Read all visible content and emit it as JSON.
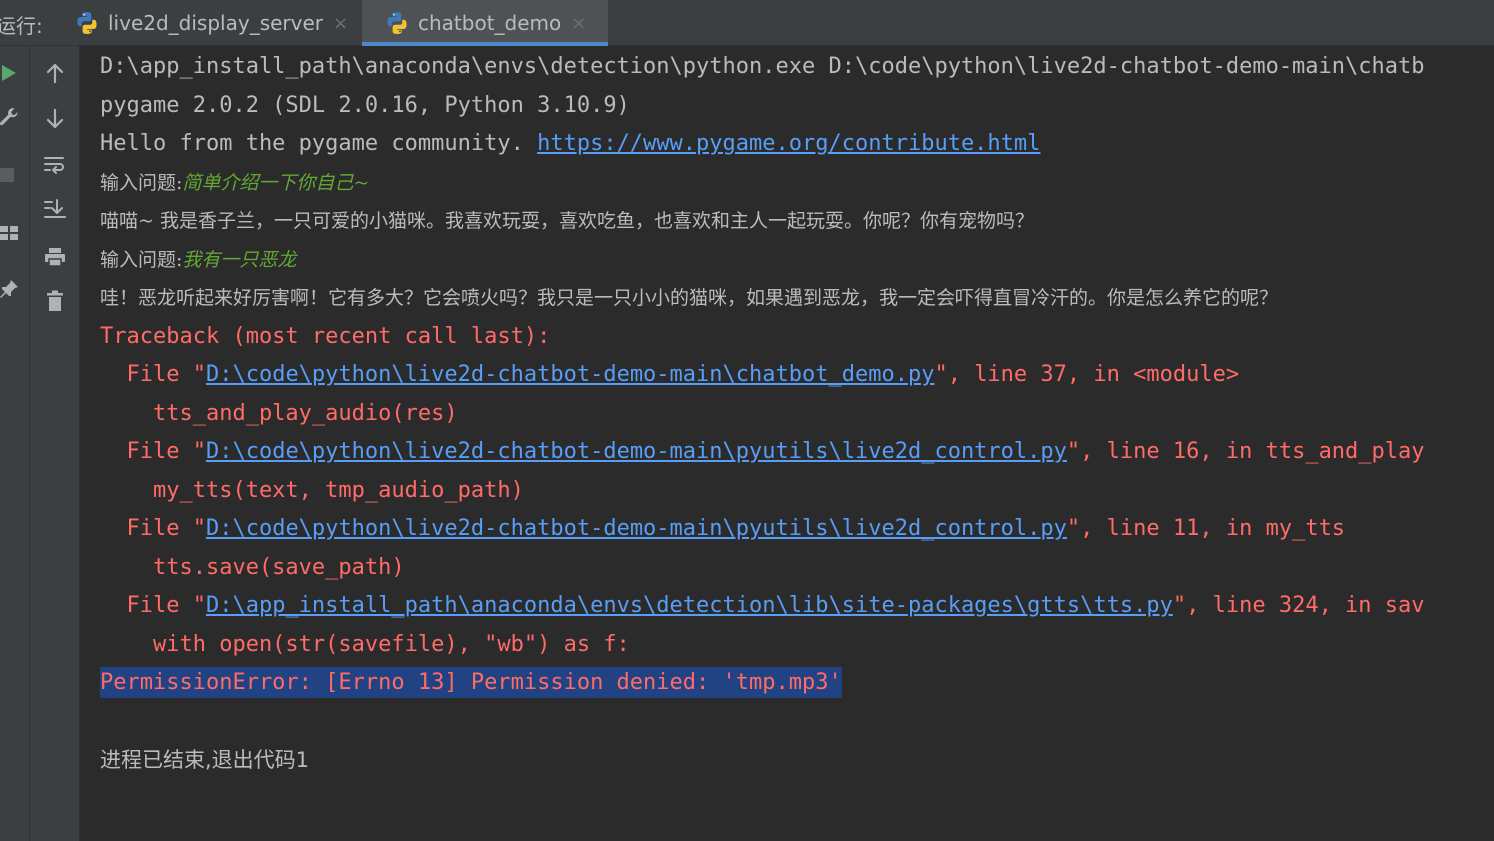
{
  "toolwindow": {
    "run_label": "运行:",
    "tabs": [
      {
        "label": "live2d_display_server",
        "icon": "python-icon",
        "close": "×",
        "active": false
      },
      {
        "label": "chatbot_demo",
        "icon": "python-icon",
        "close": "×",
        "active": true
      }
    ]
  },
  "toolbar_left": {
    "icons": [
      "run-icon",
      "wrench-icon",
      "stop-icon",
      "layout-icon",
      "pin-icon"
    ]
  },
  "toolbar_right": {
    "icons": [
      "arrow-up-icon",
      "arrow-down-icon",
      "soft-wrap-icon",
      "scroll-to-end-icon",
      "print-icon",
      "trash-icon"
    ]
  },
  "console": {
    "cmd_line": "D:\\app_install_path\\anaconda\\envs\\detection\\python.exe D:\\code\\python\\live2d-chatbot-demo-main\\chatb",
    "pygame_version": "pygame 2.0.2 (SDL 2.0.16, Python 3.10.9)",
    "hello_prefix": "Hello from the pygame community. ",
    "hello_link": "https://www.pygame.org/contribute.html",
    "prompt_label": "输入问题:",
    "input_1": "简单介绍一下你自己~",
    "reply_1": "喵喵~ 我是香子兰，一只可爱的小猫咪。我喜欢玩耍，喜欢吃鱼，也喜欢和主人一起玩耍。你呢？你有宠物吗？",
    "input_2": "我有一只恶龙",
    "reply_2": "哇！恶龙听起来好厉害啊！它有多大？它会喷火吗？我只是一只小小的猫咪，如果遇到恶龙，我一定会吓得直冒冷汗的。你是怎么养它的呢？",
    "traceback_header": "Traceback (most recent call last):",
    "frames": [
      {
        "prefix": "  File \"",
        "path": "D:\\code\\python\\live2d-chatbot-demo-main\\chatbot_demo.py",
        "suffix": "\", line 37, in <module>",
        "code": "    tts_and_play_audio(res)"
      },
      {
        "prefix": "  File \"",
        "path": "D:\\code\\python\\live2d-chatbot-demo-main\\pyutils\\live2d_control.py",
        "suffix": "\", line 16, in tts_and_play",
        "code": "    my_tts(text, tmp_audio_path)"
      },
      {
        "prefix": "  File \"",
        "path": "D:\\code\\python\\live2d-chatbot-demo-main\\pyutils\\live2d_control.py",
        "suffix": "\", line 11, in my_tts",
        "code": "    tts.save(save_path)"
      },
      {
        "prefix": "  File \"",
        "path": "D:\\app_install_path\\anaconda\\envs\\detection\\lib\\site-packages\\gtts\\tts.py",
        "suffix": "\", line 324, in sav",
        "code": "    with open(str(savefile), \"wb\") as f:"
      }
    ],
    "error_line": "PermissionError: [Errno 13] Permission denied: 'tmp.mp3'",
    "exit_line": "进程已结束,退出代码1"
  },
  "colors": {
    "background": "#2b2b2b",
    "panel": "#3c3f41",
    "text": "#bbbbbb",
    "user_input": "#62a834",
    "error": "#ff6b68",
    "link": "#589df6",
    "selection": "#214283",
    "tab_underline": "#4a88c7"
  }
}
